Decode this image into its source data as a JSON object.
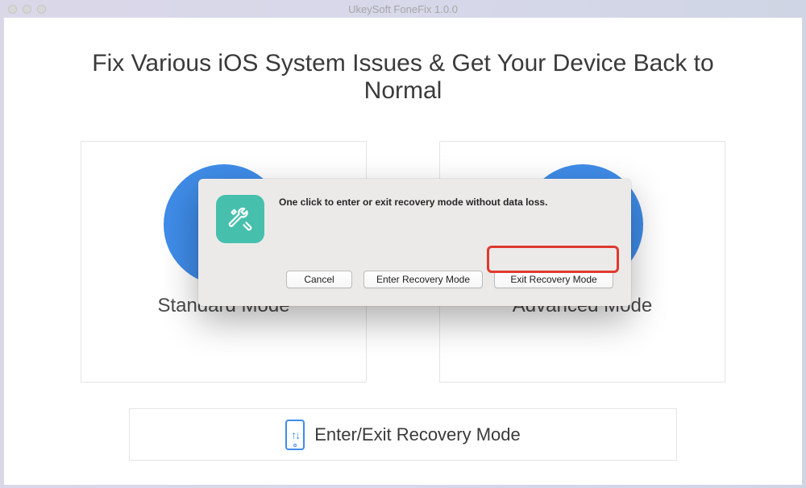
{
  "window": {
    "title": "UkeySoft FoneFix 1.0.0"
  },
  "main": {
    "headline": "Fix Various iOS System Issues & Get Your Device Back to Normal",
    "modes": {
      "standard": "Standard Mode",
      "advanced": "Advanced Mode"
    },
    "recovery_bar": "Enter/Exit Recovery Mode"
  },
  "dialog": {
    "message": "One click to enter or exit recovery mode without data loss.",
    "buttons": {
      "cancel": "Cancel",
      "enter": "Enter Recovery Mode",
      "exit": "Exit Recovery Mode"
    }
  },
  "icons": {
    "tools": "tools-icon",
    "phone_arrows": "phone-arrows-icon"
  },
  "colors": {
    "accent_blue": "#3f8ce8",
    "dialog_icon_bg": "#46c0ac",
    "highlight_red": "#e03a2f"
  }
}
